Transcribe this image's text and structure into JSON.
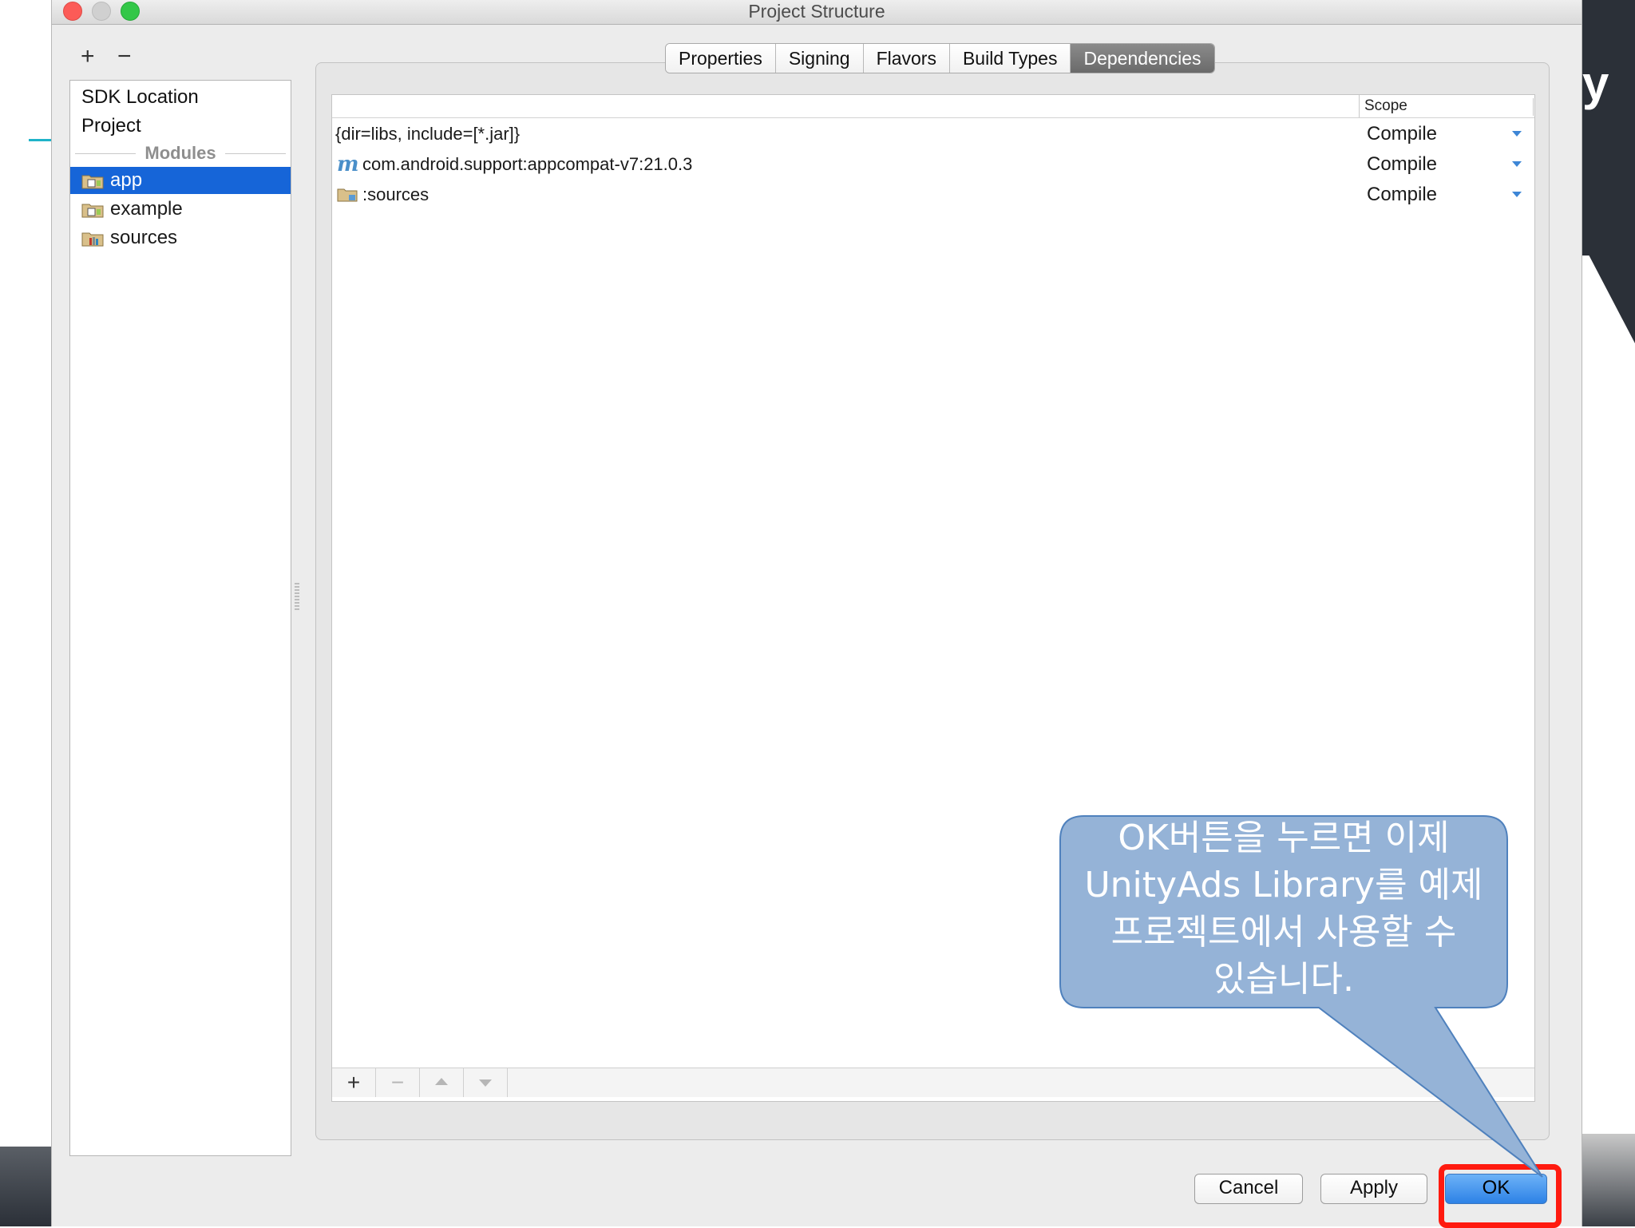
{
  "window": {
    "title": "Project Structure"
  },
  "background_slide": {
    "title_fragment": "y"
  },
  "left_panel": {
    "add_label": "+",
    "remove_label": "−",
    "items": [
      {
        "label": "SDK Location"
      },
      {
        "label": "Project"
      }
    ],
    "modules_header": "Modules",
    "modules": [
      {
        "label": "app",
        "selected": true,
        "icon": "android-module-icon"
      },
      {
        "label": "example",
        "selected": false,
        "icon": "android-module-icon"
      },
      {
        "label": "sources",
        "selected": false,
        "icon": "library-module-icon"
      }
    ]
  },
  "tabs": [
    {
      "label": "Properties",
      "active": false
    },
    {
      "label": "Signing",
      "active": false
    },
    {
      "label": "Flavors",
      "active": false
    },
    {
      "label": "Build Types",
      "active": false
    },
    {
      "label": "Dependencies",
      "active": true
    }
  ],
  "dependencies": {
    "columns": [
      "",
      "Scope"
    ],
    "rows": [
      {
        "name": "{dir=libs, include=[*.jar]}",
        "icon": "none",
        "scope": "Compile"
      },
      {
        "name": "com.android.support:appcompat-v7:21.0.3",
        "icon": "maven-icon",
        "icon_glyph": "m",
        "scope": "Compile"
      },
      {
        "name": ":sources",
        "icon": "module-folder-icon",
        "scope": "Compile"
      }
    ],
    "toolbar": {
      "add": "+",
      "remove": "−"
    }
  },
  "buttons": {
    "cancel": "Cancel",
    "apply": "Apply",
    "ok": "OK"
  },
  "callout": {
    "lines": [
      "OK버튼을 누르면 이제",
      "UnityAds Library를 예제",
      "프로젝트에서 사용할 수",
      "있습니다."
    ],
    "fill": "#95b3d7",
    "stroke": "#4f81bd"
  },
  "colors": {
    "selection": "#1665d8",
    "ok_highlight": "#ff1a0f",
    "accent_dropdown": "#3d86d6"
  }
}
